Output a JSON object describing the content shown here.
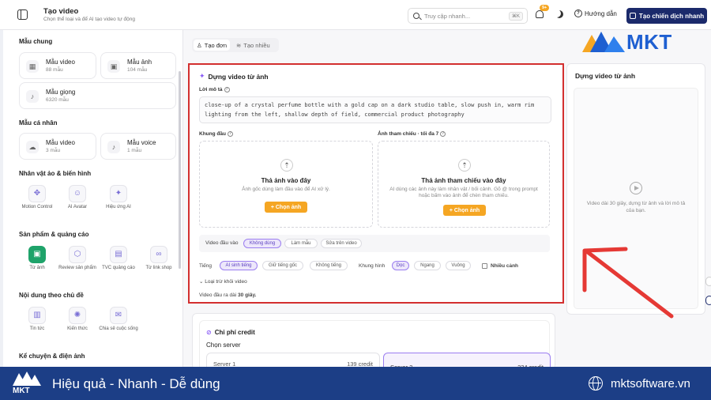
{
  "header": {
    "title": "Tạo video",
    "subtitle": "Chọn thể loại và để AI tạo video tự động",
    "search_placeholder": "Truy cập nhanh...",
    "search_shortcut": "⌘K",
    "notification_badge": "9+",
    "help_label": "Hướng dẫn",
    "campaign_button": "Tạo chiến dịch nhanh"
  },
  "sidebar": {
    "section_common": "Mẫu chung",
    "common_cards": [
      {
        "title": "Mẫu video",
        "count": "88 mẫu",
        "icon": "grid-icon"
      },
      {
        "title": "Mẫu ảnh",
        "count": "104 mẫu",
        "icon": "image-icon"
      },
      {
        "title": "Mẫu giọng",
        "count": "6320 mẫu",
        "icon": "mic-icon"
      }
    ],
    "section_personal": "Mẫu cá nhân",
    "personal_cards": [
      {
        "title": "Mẫu video",
        "count": "3 mẫu",
        "icon": "cloud-upload-icon"
      },
      {
        "title": "Mẫu voice",
        "count": "1 mẫu",
        "icon": "mic-icon"
      }
    ],
    "section_avatar": "Nhân vật ảo & biến hình",
    "avatar_tools": [
      "Motion Control",
      "AI Avatar",
      "Hiệu ứng AI"
    ],
    "section_product": "Sản phẩm & quảng cáo",
    "product_tools": [
      "Từ ảnh",
      "Review sản phẩm",
      "TVC quảng cáo",
      "Từ link shop"
    ],
    "section_topic": "Nội dung theo chủ đề",
    "topic_tools": [
      "Tin tức",
      "Kiến thức",
      "Chia sẻ cuộc sống"
    ],
    "section_story": "Kể chuyện & điện ảnh"
  },
  "tabs": {
    "single": "Tạo đơn",
    "multi": "Tạo nhiều"
  },
  "main": {
    "title": "Dựng video từ ảnh",
    "prompt_label": "Lời mô tả",
    "prompt_value": "close-up of a crystal perfume bottle with a gold cap on a dark studio table, slow push in, warm rim lighting from the left, shallow depth of field, commercial product photography",
    "first_frame_label": "Khung đầu",
    "ref_label": "Ảnh tham chiếu · tối đa 7",
    "drop1_title": "Thả ảnh vào đây",
    "drop1_desc": "Ảnh gốc dùng làm đầu vào để AI xử lý.",
    "drop2_title": "Thả ảnh tham chiếu vào đây",
    "drop2_desc": "AI dùng các ảnh này làm nhân vật / bối cảnh. Gõ @ trong prompt hoặc bấm vào ảnh để chèn tham chiếu.",
    "choose_btn": "+ Chọn ảnh",
    "input_video_label": "Video đầu vào",
    "input_video_opts": [
      "Không dùng",
      "Làm mẫu",
      "Sửa trên video"
    ],
    "sound_label": "Tiếng",
    "sound_opts": [
      "AI sinh tiếng",
      "Giữ tiếng gốc",
      "Không tiếng"
    ],
    "frame_label": "Khung hình",
    "frame_opts": [
      "Dọc",
      "Ngang",
      "Vuông"
    ],
    "multi_scene": "Nhiều cảnh",
    "exclude_label": "Loại trừ khỏi video",
    "duration_text": "Video đầu ra dài",
    "duration_value": "30 giây."
  },
  "preview": {
    "title": "Dựng video từ ảnh",
    "text": "Video dài 30 giây, dựng từ ảnh và lời mô tả của bạn."
  },
  "credit": {
    "title": "Chi phí credit",
    "server_label": "Chọn server",
    "servers": [
      {
        "name": "Server 1",
        "credit": "139 credit"
      },
      {
        "name": "Server 2",
        "credit": "234 credit"
      }
    ]
  },
  "branding": {
    "logo_text": "MKT",
    "tagline": "Hiệu quả - Nhanh - Dễ dùng",
    "site": "mktsoftware.vn"
  },
  "colors": {
    "highlight_border": "#d32f2f",
    "accent_orange": "#f5a623",
    "navy": "#1b2a6b",
    "banner": "#1c3e86",
    "brand_blue": "#1e5fd1",
    "purple": "#8a5cf6"
  }
}
